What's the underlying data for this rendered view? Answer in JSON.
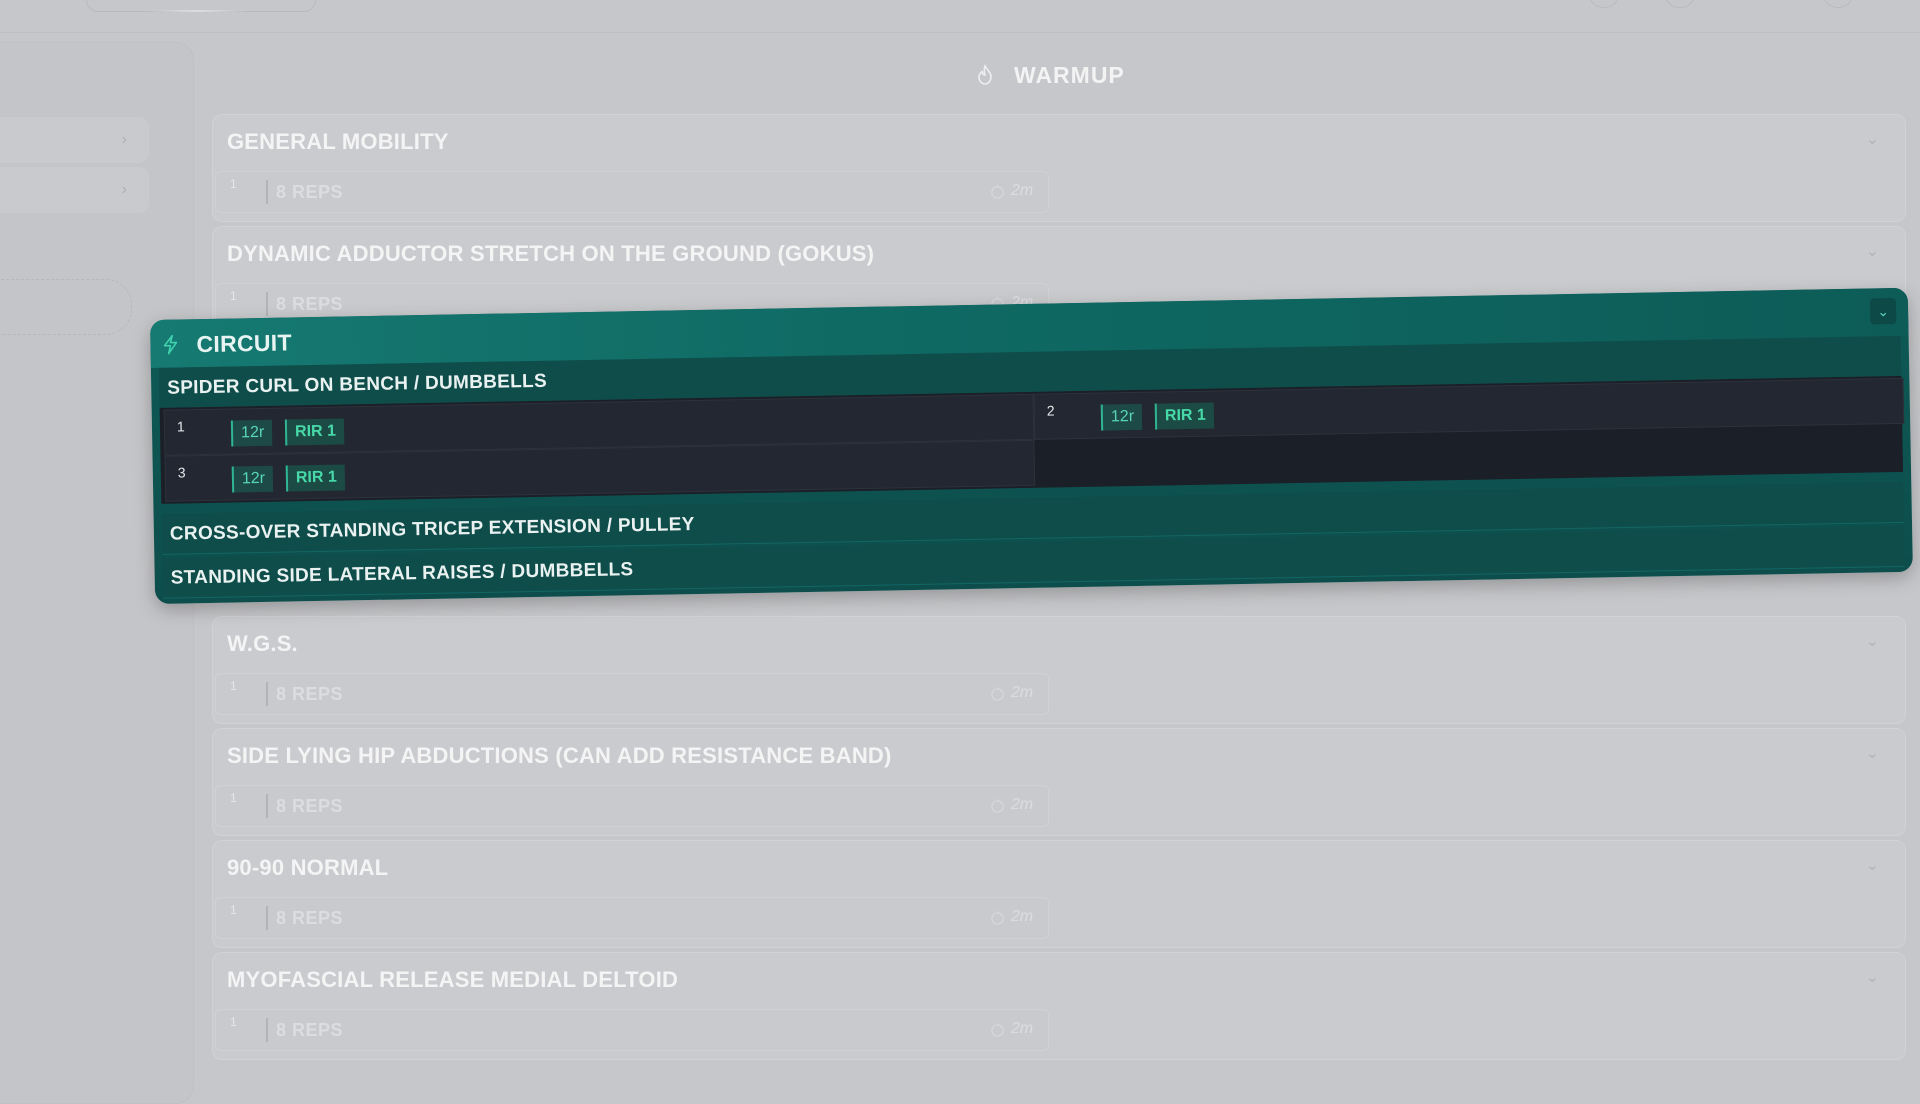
{
  "section": {
    "title": "WARMUP",
    "icon": "flame-icon"
  },
  "sidebar": {
    "items": [
      {
        "icon": "chevron-right-icon"
      },
      {
        "icon": "chevron-right-icon"
      }
    ]
  },
  "cards": [
    {
      "name": "GENERAL MOBILITY",
      "set": {
        "index": "1",
        "reps": "8 REPS",
        "rest": "2m"
      }
    },
    {
      "name": "DYNAMIC ADDUCTOR STRETCH ON THE GROUND (GOKUS)",
      "set": {
        "index": "1",
        "reps": "8 REPS",
        "rest": "2m"
      }
    },
    {
      "name": "W.G.S.",
      "set": {
        "index": "1",
        "reps": "8 REPS",
        "rest": "2m"
      }
    },
    {
      "name": "SIDE LYING HIP ABDUCTIONS (CAN ADD RESISTANCE BAND)",
      "set": {
        "index": "1",
        "reps": "8 REPS",
        "rest": "2m"
      }
    },
    {
      "name": "90-90 NORMAL",
      "set": {
        "index": "1",
        "reps": "8 REPS",
        "rest": "2m"
      }
    },
    {
      "name": "MYOFASCIAL RELEASE MEDIAL DELTOID",
      "set": {
        "index": "1",
        "reps": "8 REPS",
        "rest": "2m"
      }
    }
  ],
  "circuit": {
    "label": "CIRCUIT",
    "colors": {
      "accent": "#2fb592",
      "header": "#167a72",
      "dark": "#1b1f27"
    },
    "exercises": [
      {
        "name": "SPIDER CURL ON BENCH / DUMBBELLS",
        "sets": [
          {
            "index": "1",
            "reps": "12r",
            "rir": "RIR 1"
          },
          {
            "index": "2",
            "reps": "12r",
            "rir": "RIR 1"
          },
          {
            "index": "3",
            "reps": "12r",
            "rir": "RIR 1"
          }
        ]
      },
      {
        "name": "CROSS-OVER STANDING TRICEP EXTENSION / PULLEY"
      },
      {
        "name": "STANDING SIDE LATERAL RAISES / DUMBBELLS"
      }
    ]
  }
}
